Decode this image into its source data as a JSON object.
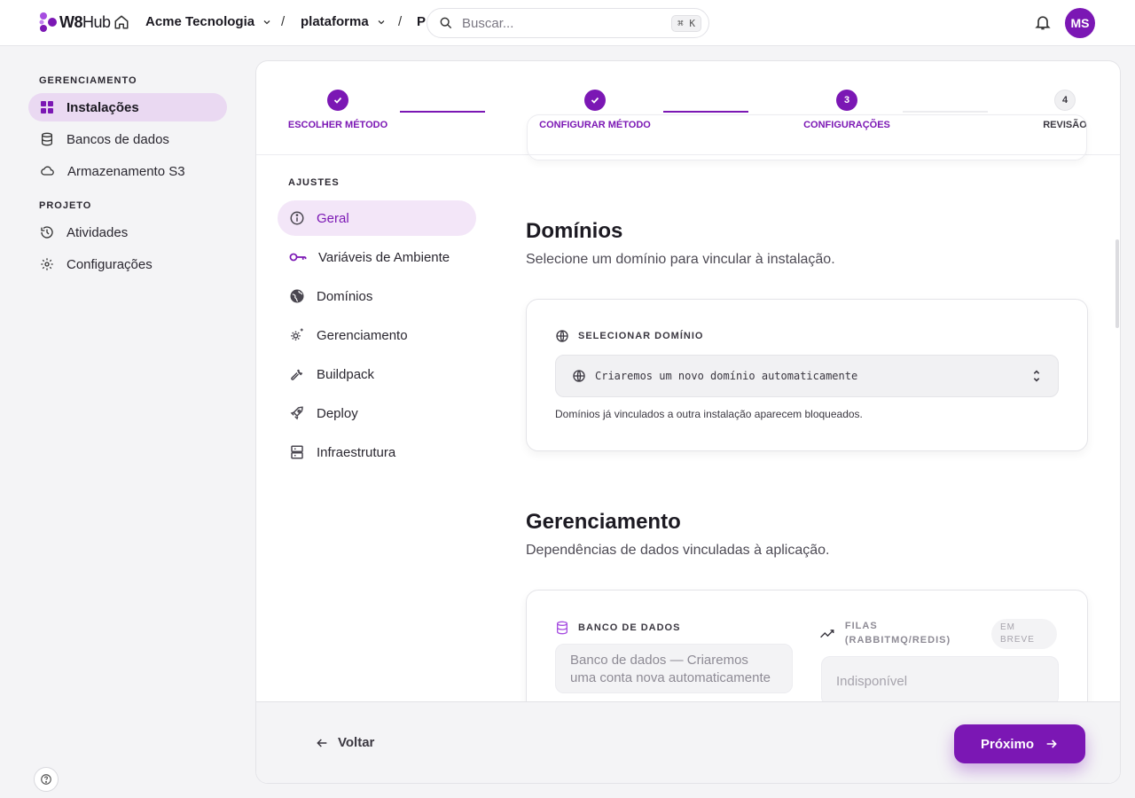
{
  "topbar": {
    "logo_bold": "W8",
    "logo_light": "Hub",
    "org": "Acme Tecnologia",
    "separator": "/",
    "project": "plataforma",
    "crumb_next": "P",
    "search_placeholder": "Buscar...",
    "search_shortcut": "⌘ K",
    "avatar_initials": "MS"
  },
  "sidebar": {
    "section_manage": "GERENCIAMENTO",
    "section_project": "PROJETO",
    "items": [
      {
        "label": "Instalações",
        "icon": "grid-icon",
        "active": true
      },
      {
        "label": "Bancos de dados",
        "icon": "database-icon"
      },
      {
        "label": "Armazenamento S3",
        "icon": "cloud-icon"
      },
      {
        "label": "Atividades",
        "icon": "history-icon"
      },
      {
        "label": "Configurações",
        "icon": "gear-icon"
      }
    ]
  },
  "stepper": {
    "steps": [
      {
        "label": "ESCOLHER MÉTODO",
        "state": "done"
      },
      {
        "label": "CONFIGURAR MÉTODO",
        "state": "done"
      },
      {
        "label": "CONFIGURAÇÕES",
        "state": "current",
        "number": "3"
      },
      {
        "label": "REVISÃO",
        "state": "pending",
        "number": "4"
      }
    ]
  },
  "settings_nav": {
    "heading": "AJUSTES",
    "items": [
      {
        "label": "Geral",
        "icon": "info-icon",
        "active": true
      },
      {
        "label": "Variáveis de Ambiente",
        "icon": "key-icon"
      },
      {
        "label": "Domínios",
        "icon": "globe-icon"
      },
      {
        "label": "Gerenciamento",
        "icon": "cog-sparkle-icon"
      },
      {
        "label": "Buildpack",
        "icon": "wrench-icon"
      },
      {
        "label": "Deploy",
        "icon": "rocket-icon"
      },
      {
        "label": "Infraestrutura",
        "icon": "server-icon"
      }
    ]
  },
  "domains": {
    "title": "Domínios",
    "subtitle": "Selecione um domínio para vincular à instalação.",
    "field_label": "SELECIONAR DOMÍNIO",
    "select_value": "Criaremos um novo domínio automaticamente",
    "hint": "Domínios já vinculados a outra instalação aparecem bloqueados."
  },
  "management": {
    "title": "Gerenciamento",
    "subtitle": "Dependências de dados vinculadas à aplicação.",
    "database_label": "BANCO DE DADOS",
    "database_value": "Banco de dados — Criaremos uma conta nova automaticamente",
    "queues_label": "FILAS (RABBITMQ/REDIS)",
    "queues_badge": "EM BREVE",
    "queues_value": "Indisponível"
  },
  "footer": {
    "back_label": "Voltar",
    "next_label": "Próximo"
  },
  "colors": {
    "accent": "#7b17b4",
    "accent_soft": "#f3e6f8"
  }
}
